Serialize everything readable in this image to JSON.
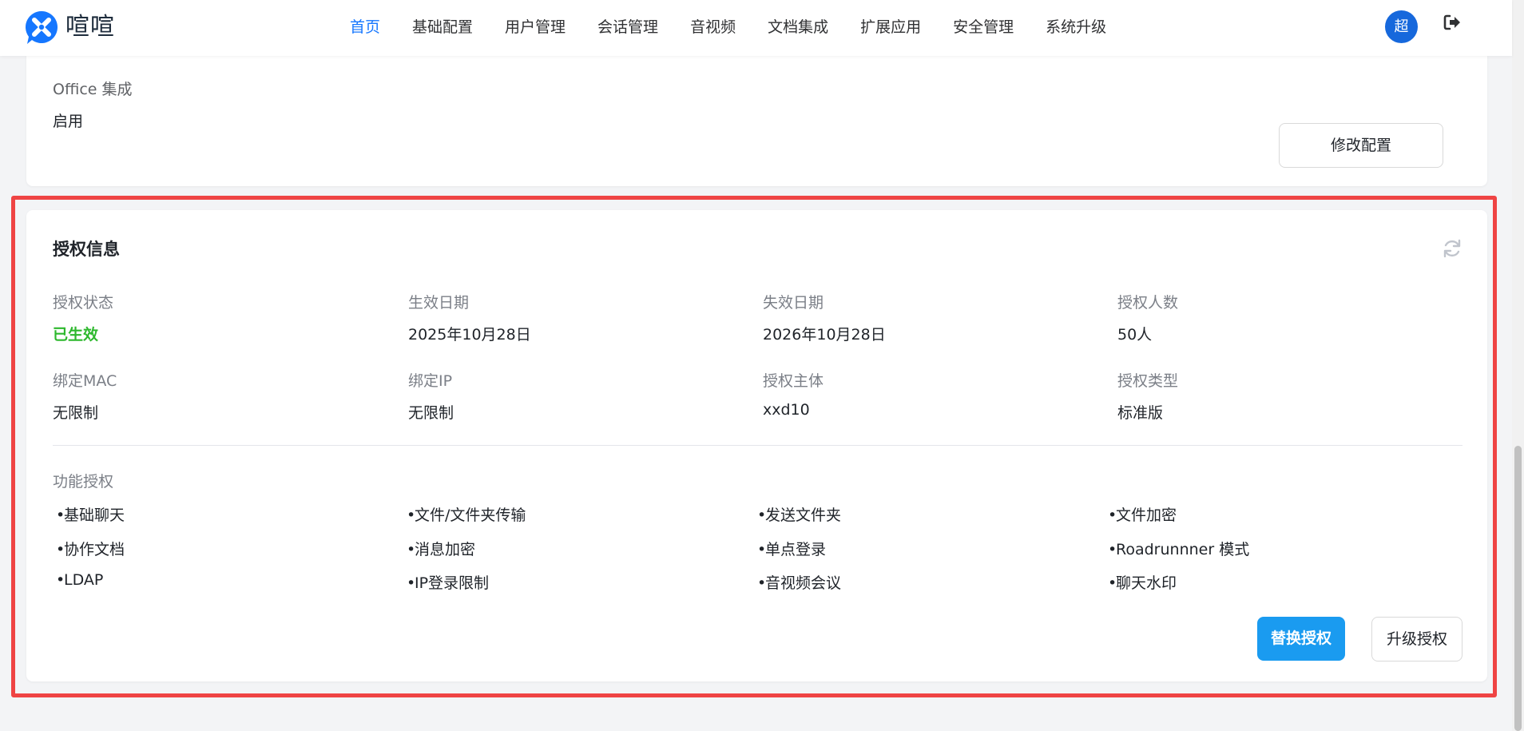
{
  "brand": {
    "name": "喧喧",
    "logo_icon": "xuanxuan-logo-icon",
    "logo_color": "#1677ff"
  },
  "nav": {
    "items": [
      {
        "label": "首页",
        "active": true
      },
      {
        "label": "基础配置"
      },
      {
        "label": "用户管理"
      },
      {
        "label": "会话管理"
      },
      {
        "label": "音视频"
      },
      {
        "label": "文档集成"
      },
      {
        "label": "扩展应用"
      },
      {
        "label": "安全管理"
      },
      {
        "label": "系统升级"
      }
    ],
    "active_color": "#1677ff"
  },
  "user": {
    "avatar_text": "超",
    "avatar_color": "#1668dc",
    "logout_icon": "logout-icon"
  },
  "office_section": {
    "title": "Office 集成",
    "value": "启用",
    "edit_button": "修改配置"
  },
  "license": {
    "title": "授权信息",
    "refresh_icon": "refresh-icon",
    "fields": [
      {
        "label": "授权状态",
        "value": "已生效",
        "status_color": "#2eb82e"
      },
      {
        "label": "生效日期",
        "value": "2025年10月28日"
      },
      {
        "label": "失效日期",
        "value": "2026年10月28日"
      },
      {
        "label": "授权人数",
        "value": "50人"
      },
      {
        "label": "绑定MAC",
        "value": "无限制"
      },
      {
        "label": "绑定IP",
        "value": "无限制"
      },
      {
        "label": "授权主体",
        "value": "xxd10"
      },
      {
        "label": "授权类型",
        "value": "标准版"
      }
    ],
    "features_label": "功能授权",
    "features": [
      "基础聊天",
      "文件/文件夹传输",
      "发送文件夹",
      "文件加密",
      "协作文档",
      "消息加密",
      "单点登录",
      "Roadrunnner 模式",
      "LDAP",
      "IP登录限制",
      "音视频会议",
      "聊天水印"
    ],
    "replace_button": "替换授权",
    "upgrade_button": "升级授权",
    "highlight_color": "#ef4444"
  }
}
